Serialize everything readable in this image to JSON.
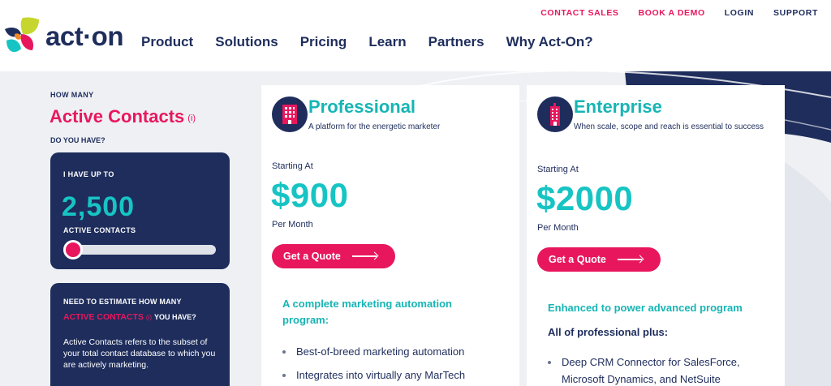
{
  "utility_nav": {
    "contact_sales": "CONTACT SALES",
    "book_demo": "BOOK A DEMO",
    "login": "LOGIN",
    "support": "SUPPORT"
  },
  "brand": {
    "name": "act·on"
  },
  "main_nav": [
    "Product",
    "Solutions",
    "Pricing",
    "Learn",
    "Partners",
    "Why Act-On?"
  ],
  "contacts_selector": {
    "how_many": "HOW MANY",
    "title": "Active Contacts",
    "info_marker": "(i)",
    "do_you_have": "DO YOU HAVE?",
    "up_to_label": "I HAVE UP TO",
    "value": "2,500",
    "unit_label": "ACTIVE CONTACTS",
    "slider_fraction": 0.0
  },
  "estimate": {
    "heading": "NEED TO ESTIMATE HOW MANY",
    "highlight": "ACTIVE CONTACTS",
    "info_marker": "(i)",
    "suffix": "YOU HAVE?",
    "description": "Active Contacts refers to the subset of your total contact database to which you are actively marketing."
  },
  "plans": {
    "professional": {
      "name": "Professional",
      "tagline": "A platform for the energetic marketer",
      "starting_at": "Starting At",
      "price": "$900",
      "period": "Per Month",
      "cta": "Get a Quote",
      "program_heading": "A complete marketing automation program:",
      "features": [
        "Best-of-breed marketing automation",
        "Integrates into virtually any MarTech"
      ]
    },
    "enterprise": {
      "name": "Enterprise",
      "tagline": "When scale, scope and reach is essential to success",
      "starting_at": "Starting At",
      "price": "$2000",
      "period": "Per Month",
      "cta": "Get a Quote",
      "program_heading": "Enhanced to power advanced program",
      "plus_heading": "All of professional plus:",
      "features": [
        "Deep CRM Connector for SalesForce, Microsoft Dynamics, and NetSuite"
      ]
    }
  },
  "colors": {
    "navy": "#1e2d5c",
    "pink": "#e8175d",
    "teal": "#17c4c4",
    "background": "#eef0f4"
  },
  "icons": {
    "professional": "building-icon",
    "enterprise": "skyscraper-icon",
    "cta_arrow": "arrow-right-icon"
  }
}
